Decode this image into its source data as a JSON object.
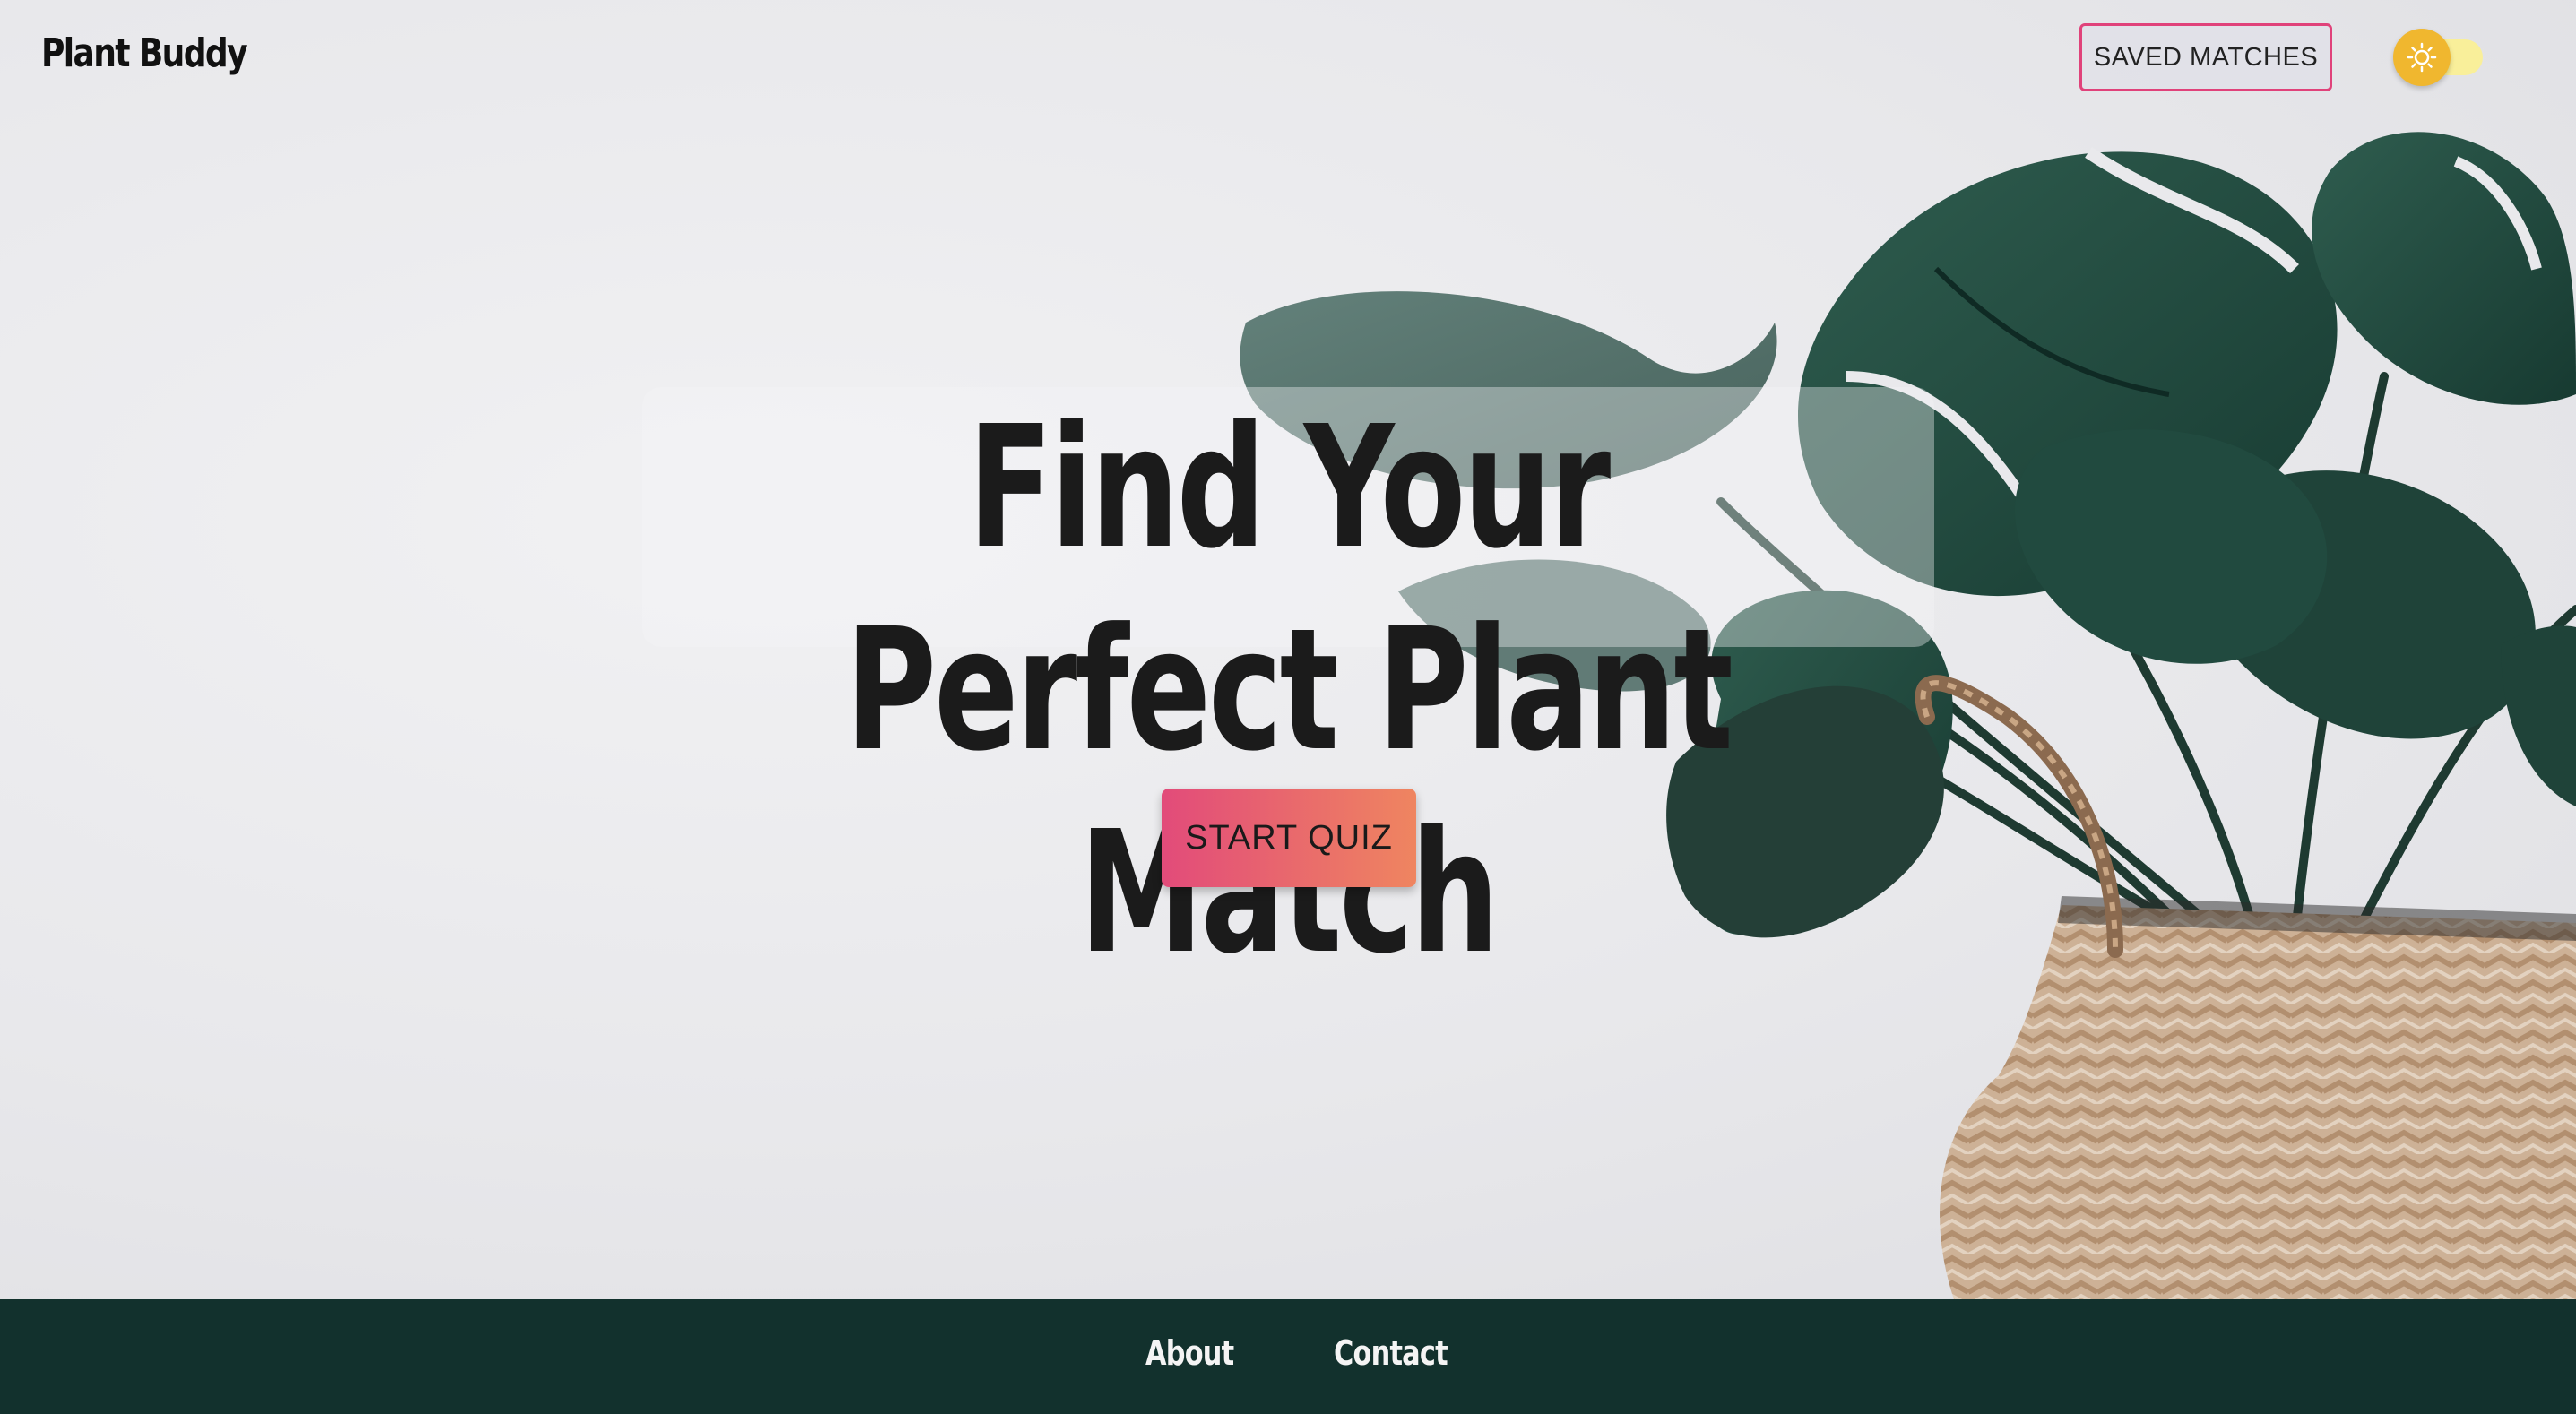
{
  "app": {
    "brand": "Plant Buddy"
  },
  "header": {
    "saved_matches_label": "SAVED MATCHES",
    "theme_toggle_icon": "sun-icon"
  },
  "hero": {
    "title": "Find Your Perfect Plant Match",
    "cta_label": "START QUIZ"
  },
  "footer": {
    "links": [
      {
        "label": "About"
      },
      {
        "label": "Contact"
      }
    ]
  },
  "colors": {
    "accent_pink": "#e0427a",
    "cta_gradient_start": "#e24b7a",
    "cta_gradient_end": "#ef8560",
    "footer_bg": "#12312d",
    "toggle_knob": "#f0b72f",
    "toggle_track": "#f9ef9a"
  }
}
